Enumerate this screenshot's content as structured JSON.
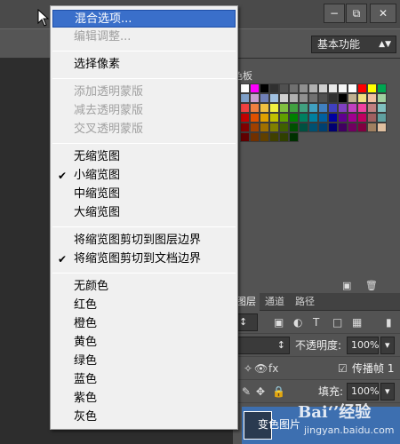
{
  "window_controls": {
    "minimize": "−",
    "restore": "⧉",
    "close": "✕"
  },
  "options_bar": {
    "workspace": "基本功能"
  },
  "swatches_panel": {
    "tab_label": "色板"
  },
  "layers_panel": {
    "tabs": [
      "图层",
      "通道",
      "路径"
    ],
    "opacity_label": "不透明度:",
    "opacity_value": "100%",
    "lock_label": "传播帧 1",
    "fill_label": "填充:",
    "fill_value": "100%",
    "layer_name": "变色图片"
  },
  "watermark": {
    "logo": "Bai‘’经验",
    "url": "jingyan.baidu.com"
  },
  "menu": {
    "items": [
      {
        "label": "混合选项...",
        "state": "highlight"
      },
      {
        "label": "编辑调整...",
        "state": "disabled"
      },
      {
        "label": "选择像素",
        "state": "normal"
      },
      {
        "label": "添加透明蒙版",
        "state": "disabled"
      },
      {
        "label": "减去透明蒙版",
        "state": "disabled"
      },
      {
        "label": "交叉透明蒙版",
        "state": "disabled"
      },
      {
        "label": "无缩览图",
        "state": "normal"
      },
      {
        "label": "小缩览图",
        "state": "checked"
      },
      {
        "label": "中缩览图",
        "state": "normal"
      },
      {
        "label": "大缩览图",
        "state": "normal"
      },
      {
        "label": "将缩览图剪切到图层边界",
        "state": "normal"
      },
      {
        "label": "将缩览图剪切到文档边界",
        "state": "checked"
      },
      {
        "label": "无颜色",
        "state": "normal"
      },
      {
        "label": "红色",
        "state": "normal"
      },
      {
        "label": "橙色",
        "state": "normal"
      },
      {
        "label": "黄色",
        "state": "normal"
      },
      {
        "label": "绿色",
        "state": "normal"
      },
      {
        "label": "蓝色",
        "state": "normal"
      },
      {
        "label": "紫色",
        "state": "normal"
      },
      {
        "label": "灰色",
        "state": "normal"
      }
    ],
    "check_glyph": "✔"
  },
  "colors": {
    "menu_highlight": "#3a6fca",
    "selected_layer": "#3d6fb0",
    "swatch_palette": [
      "#ffffff",
      "#ff00ff",
      "#000000",
      "#303030",
      "#505050",
      "#707070",
      "#909090",
      "#b0b0b0",
      "#d0d0d0",
      "#e8e8e8",
      "#f5f5f5",
      "#ffffff",
      "#ff0000",
      "#ffff00",
      "#00a651",
      "#7fa0c8",
      "#c8a0d0",
      "#7080b8",
      "#a0c0e0",
      "#d0d0d0",
      "#b0b0b0",
      "#909090",
      "#707070",
      "#505050",
      "#303030",
      "#000000",
      "#c0b090",
      "#f0e080",
      "#f0c0a0",
      "#a0d0a0",
      "#f04040",
      "#f08040",
      "#f0c040",
      "#f0f040",
      "#80c040",
      "#40a040",
      "#40a080",
      "#40a0c0",
      "#4080c0",
      "#4040c0",
      "#8040c0",
      "#c040c0",
      "#f040a0",
      "#c08080",
      "#80c0c0",
      "#c00000",
      "#e05000",
      "#e0a000",
      "#c0c000",
      "#60a000",
      "#008000",
      "#008060",
      "#0080a0",
      "#0060a0",
      "#0000a0",
      "#600090",
      "#a00090",
      "#c00060",
      "#a06060",
      "#60a0a0",
      "#800000",
      "#a04000",
      "#a07000",
      "#808000",
      "#406000",
      "#005000",
      "#005040",
      "#005070",
      "#004070",
      "#000070",
      "#400060",
      "#700060",
      "#800040",
      "#a08060",
      "#e0c0a0",
      "#600000",
      "#703000",
      "#604000",
      "#404000",
      "#304000",
      "#003000"
    ]
  }
}
